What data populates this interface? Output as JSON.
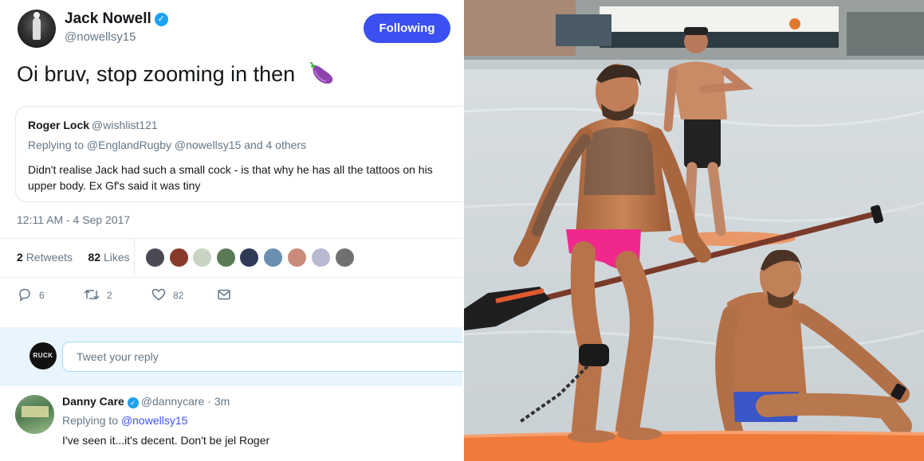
{
  "tweet": {
    "author_name": "Jack Nowell",
    "author_handle": "@nowellsy15",
    "follow_label": "Following",
    "text": "Oi bruv, stop zooming in then",
    "emoji": "eggplant-icon",
    "timestamp": "12:11 AM - 4 Sep 2017",
    "retweets": "2",
    "retweets_label": "Retweets",
    "likes": "82",
    "likes_label": "Likes",
    "actions": {
      "reply_count": "6",
      "retweet_count": "2",
      "like_count": "82"
    }
  },
  "quoted": {
    "name": "Roger Lock",
    "handle": "@wishlist121",
    "replying_to": "Replying to @EnglandRugby @nowellsy15 and 4 others",
    "body": "Didn't realise Jack had such a small cock - is that why he has all the tattoos on his upper body. Ex Gf's said it was tiny"
  },
  "reply_box": {
    "avatar_text": "RUCK",
    "placeholder": "Tweet your reply"
  },
  "reply": {
    "name": "Danny Care",
    "handle_time": "@dannycare · 3m",
    "replying_prefix": "Replying to",
    "replying_handle": "@nowellsy15",
    "body": "I've seen it...it's decent. Don't be jel Roger"
  },
  "colors": {
    "accent": "#3b50f0",
    "verified": "#1da1f2",
    "muted": "#657786",
    "reply_bg": "#e8f5fd",
    "paddleboard": "#f07a3a",
    "swim_briefs": "#f0288c"
  }
}
